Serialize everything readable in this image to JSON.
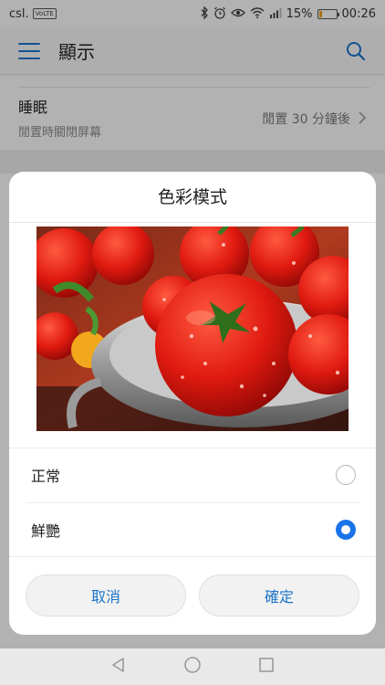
{
  "status_bar": {
    "carrier": "csl.",
    "network_badge": "VoLTE",
    "battery_text": "15%",
    "battery_level": 0.15,
    "time": "00:26",
    "icons": [
      "bluetooth-icon",
      "alarm-icon",
      "eye-comfort-icon",
      "wifi-icon",
      "signal-icon",
      "battery-icon"
    ]
  },
  "app_bar": {
    "title": "顯示",
    "accent": "#1a73c8"
  },
  "background_list": {
    "sleep_title": "睡眠",
    "sleep_subtitle": "閒置時關閉屏幕",
    "sleep_value": "閒置 30 分鐘後"
  },
  "dialog": {
    "title": "色彩模式",
    "preview_image": "tomatoes-in-colander",
    "options": [
      {
        "label": "正常",
        "selected": false
      },
      {
        "label": "鮮艷",
        "selected": true
      }
    ],
    "cancel_label": "取消",
    "confirm_label": "確定",
    "radio_color": "#1a73e8"
  },
  "nav_bar": {
    "icons": [
      "back-icon",
      "home-icon",
      "recents-icon"
    ]
  }
}
